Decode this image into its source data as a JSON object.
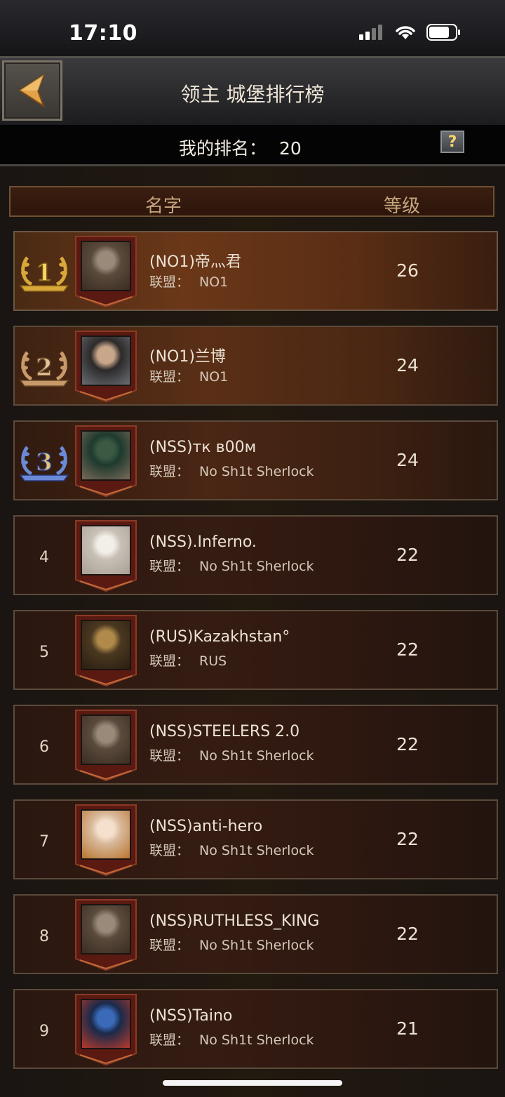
{
  "status_bar": {
    "time": "17:10"
  },
  "header": {
    "title": "领主 城堡排行榜"
  },
  "my_rank": {
    "label": "我的排名：",
    "value": "20",
    "help": "?"
  },
  "columns": {
    "name": "名字",
    "level": "等级"
  },
  "alliance_label": "联盟：",
  "rows": [
    {
      "rank": "1",
      "name": "(NO1)帝灬君",
      "alliance": "NO1",
      "level": "26",
      "avatar": "grey-bearded-warrior"
    },
    {
      "rank": "2",
      "name": "(NO1)兰博",
      "alliance": "NO1",
      "level": "24",
      "avatar": "dark-haired-knight"
    },
    {
      "rank": "3",
      "name": "(NSS)тк в00м",
      "alliance": "No Sh1t Sherlock",
      "level": "24",
      "avatar": "green-hat-man"
    },
    {
      "rank": "4",
      "name": "(NSS).Inferno.",
      "alliance": "No Sh1t Sherlock",
      "level": "22",
      "avatar": "white-cat"
    },
    {
      "rank": "5",
      "name": "(RUS)Kazakhstan°",
      "alliance": "RUS",
      "level": "22",
      "avatar": "lion"
    },
    {
      "rank": "6",
      "name": "(NSS)STEELERS 2.0",
      "alliance": "No Sh1t Sherlock",
      "level": "22",
      "avatar": "grey-bearded-warrior"
    },
    {
      "rank": "7",
      "name": "(NSS)anti-hero",
      "alliance": "No Sh1t Sherlock",
      "level": "22",
      "avatar": "red-haired-lady"
    },
    {
      "rank": "8",
      "name": "(NSS)RUTHLESS_KING",
      "alliance": "No Sh1t Sherlock",
      "level": "22",
      "avatar": "grey-bearded-warrior"
    },
    {
      "rank": "9",
      "name": "(NSS)Taino",
      "alliance": "No Sh1t Sherlock",
      "level": "21",
      "avatar": "painted-warrior"
    }
  ]
}
